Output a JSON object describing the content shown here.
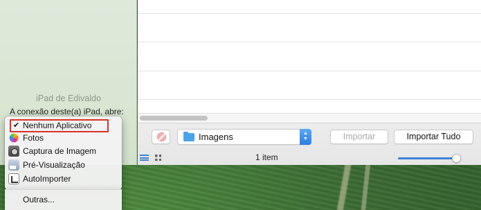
{
  "sidebar": {
    "device_name": "iPad de Edivaldo",
    "connection_label": "A conexão deste(a) iPad, abre:"
  },
  "menu": {
    "items": [
      {
        "label": "Nenhum Aplicativo",
        "selected": true,
        "icon": "checkmark-icon"
      },
      {
        "label": "Fotos",
        "icon": "photos-icon"
      },
      {
        "label": "Captura de Imagem",
        "icon": "image-capture-icon"
      },
      {
        "label": "Pré-Visualização",
        "icon": "preview-icon"
      },
      {
        "label": "AutoImporter",
        "icon": "autoimporter-icon"
      }
    ],
    "other_label": "Outras..."
  },
  "toolbar": {
    "folder_label": "Imagens",
    "import_label": "Importar",
    "import_all_label": "Importar Tudo",
    "item_count": "1 item",
    "thumbnail_size": 0.93
  },
  "colors": {
    "accent": "#3b82d9",
    "selection_outline": "#d8322a"
  }
}
